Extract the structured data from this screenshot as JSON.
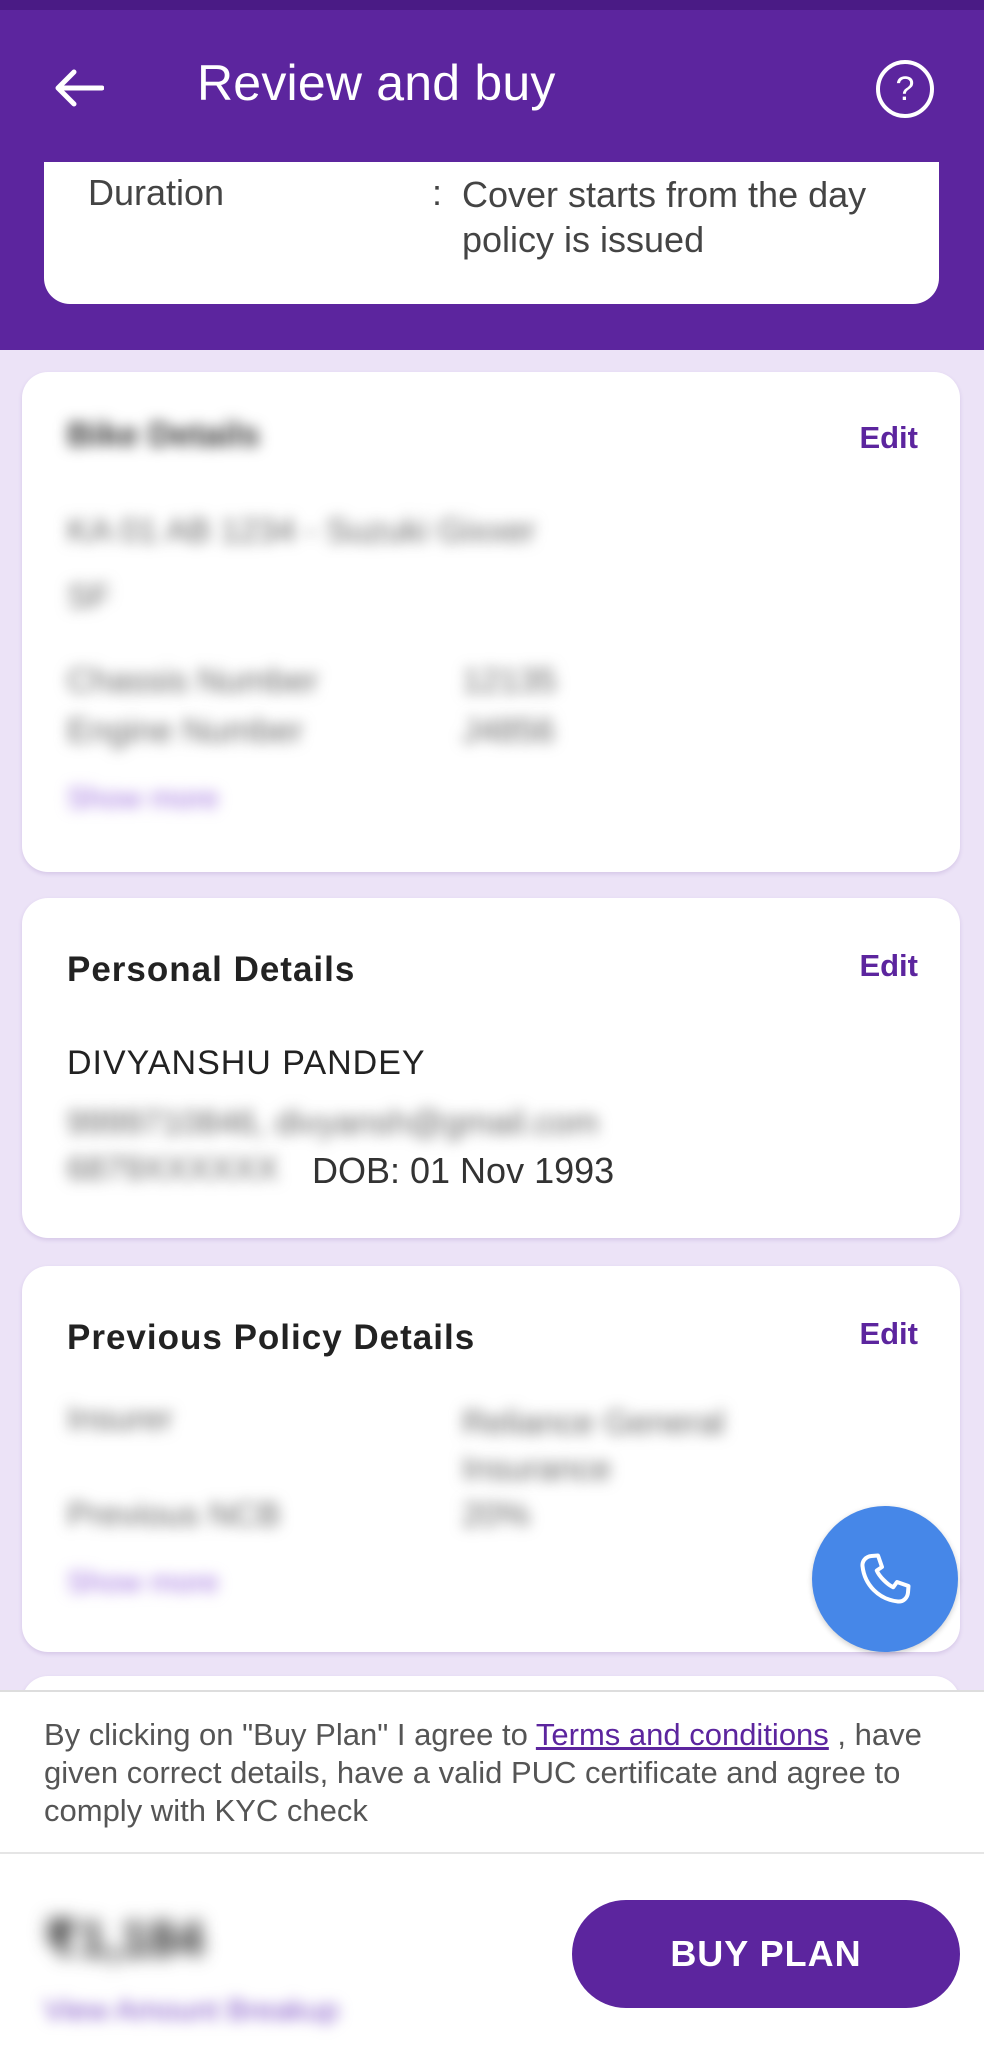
{
  "header": {
    "title": "Review and buy",
    "back_icon": "arrow-left-icon",
    "help_icon": "question-circle-icon",
    "help_glyph": "?"
  },
  "summary": {
    "duration_label": "Duration",
    "colon": ":",
    "duration_value": "Cover starts from the day policy is issued"
  },
  "bike_card": {
    "heading_blurred": "Bike Details",
    "edit_label": "Edit",
    "line1_blurred": "KA 01 AB 1234 - Suzuki Gixxer",
    "line2_blurred": "SF",
    "chassis_label_blurred": "Chassis Number",
    "chassis_value_blurred": "12135",
    "engine_label_blurred": "Engine Number",
    "engine_value_blurred": "J4856",
    "show_more_blurred": "Show more"
  },
  "personal_card": {
    "heading": "Personal Details",
    "edit_label": "Edit",
    "name": "DIVYANSHU PANDEY",
    "contact_blurred": "9999710846, divyansh@gmail.com",
    "dob_text": "DOB: 01 Nov 1993",
    "address_blurred": "6879XXXXXX"
  },
  "previous_policy_card": {
    "heading": "Previous Policy Details",
    "edit_label": "Edit",
    "insurer_label_blurred": "Insurer",
    "insurer_value_blurred": "Reliance General Insurance",
    "ncb_label_blurred": "Previous NCB",
    "ncb_value_blurred": "20%",
    "show_more_blurred": "Show more"
  },
  "call_button": {
    "icon": "phone-icon"
  },
  "consent": {
    "text_before": "By clicking on \"Buy Plan\" I agree to ",
    "link_text": "Terms and conditions",
    "text_after": " , have given correct details, have a valid PUC certificate and agree to comply with KYC check"
  },
  "footer": {
    "price_blurred": "₹1,184",
    "breakup_blurred": "View Amount Breakup",
    "buy_label": "BUY PLAN"
  },
  "colors": {
    "brand": "#5c259e",
    "background": "#ece3f7",
    "call_button": "#4687e8"
  }
}
